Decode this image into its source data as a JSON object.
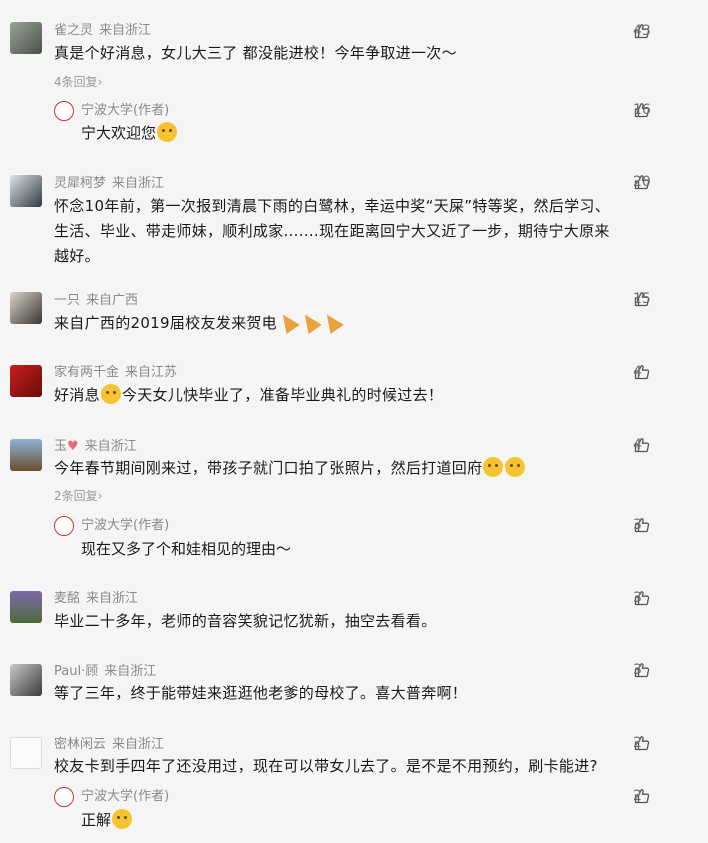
{
  "comments": [
    {
      "name": "雀之灵",
      "location": "来自浙江",
      "likes": "43",
      "text": "真是个好消息，女儿大三了 都没能进校！今年争取进一次～",
      "more": "4条回复",
      "reply": {
        "name": "宁波大学(作者)",
        "likes": "16",
        "text": "宁大欢迎您"
      }
    },
    {
      "name": "灵犀柯梦",
      "location": "来自浙江",
      "likes": "20",
      "text_lines": [
        "怀念10年前，第一次报到清晨下雨的白鹭林，幸运中奖“天屎”特等奖，然后学习、",
        "生活、毕业、带走师妹，顺利成家.......现在距离回宁大又近了一步，期待宁大原来",
        "越好。"
      ]
    },
    {
      "name": "一只",
      "location": "来自广西",
      "likes": "15",
      "text": "来自广西的2019届校友发来贺电"
    },
    {
      "name": "家有两千金",
      "location": "来自江苏",
      "likes": "4",
      "text_a": "好消息",
      "text_b": "今天女儿快毕业了，准备毕业典礼的时候过去！"
    },
    {
      "name": "玉",
      "location": "来自浙江",
      "likes": "4",
      "text": "今年春节期间刚来过，带孩子就门口拍了张照片，然后打道回府",
      "more": "2条回复",
      "reply": {
        "name": "宁波大学(作者)",
        "likes": "3",
        "text": "现在又多了个和娃相见的理由～"
      }
    },
    {
      "name": "麦酩",
      "location": "来自浙江",
      "likes": "3",
      "text": "毕业二十多年，老师的音容笑貌记忆犹新，抽空去看看。"
    },
    {
      "name": "Paul·顾",
      "location": "来自浙江",
      "likes": "3",
      "text": "等了三年，终于能带娃来逛逛他老爹的母校了。喜大普奔啊！"
    },
    {
      "name": "密林闲云",
      "location": "来自浙江",
      "likes": "2",
      "text": "校友卡到手四年了还没用过，现在可以带女儿去了。是不是不用预约，刷卡能进?",
      "reply": {
        "name": "宁波大学(作者)",
        "likes": "2",
        "text": "正解"
      }
    }
  ],
  "colors": {
    "accent_red": "#c33333",
    "text_gray": "#8a8a8a",
    "bg": "#f5f5f5"
  },
  "icons": {
    "like": "thumbs-up-icon",
    "chevron": "chevron-right-icon"
  }
}
